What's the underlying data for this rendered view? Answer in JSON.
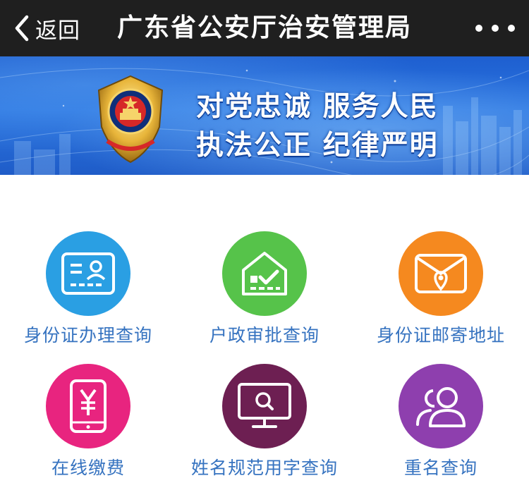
{
  "nav": {
    "back_label": "返回",
    "title": "广东省公安厅治安管理局",
    "more_icon": "more-dots-icon"
  },
  "banner": {
    "slogan_line1": "对党忠诚 服务人民",
    "slogan_line2": "执法公正 纪律严明",
    "emblem": "police-emblem-icon"
  },
  "services": [
    {
      "label": "身份证办理查询",
      "icon": "id-card-icon",
      "color": "#2a9fe3"
    },
    {
      "label": "户政审批查询",
      "icon": "house-check-icon",
      "color": "#56c34a"
    },
    {
      "label": "身份证邮寄地址",
      "icon": "envelope-location-icon",
      "color": "#f5891f"
    },
    {
      "label": "在线缴费",
      "icon": "phone-yuan-icon",
      "color": "#e8247f"
    },
    {
      "label": "姓名规范用字查询",
      "icon": "monitor-search-icon",
      "color": "#6d1f52"
    },
    {
      "label": "重名查询",
      "icon": "users-icon",
      "color": "#8e3fae"
    }
  ]
}
